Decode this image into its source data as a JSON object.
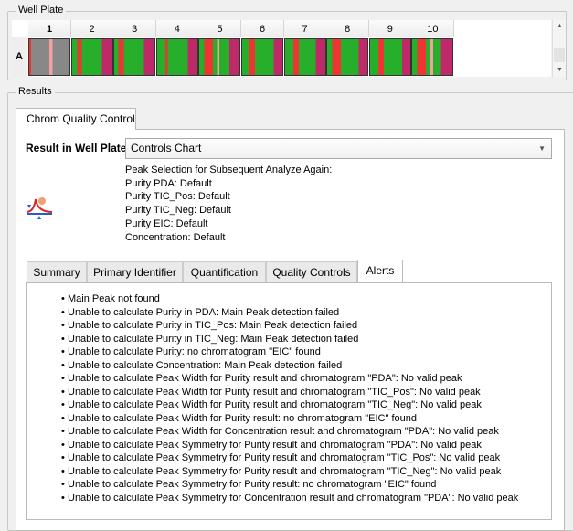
{
  "well_plate": {
    "title": "Well Plate",
    "row_label": "A",
    "columns": [
      "1",
      "2",
      "3",
      "4",
      "5",
      "6",
      "7",
      "8",
      "9",
      "10"
    ]
  },
  "results": {
    "title": "Results",
    "main_tab": "Chrom Quality Control",
    "result_label": "Result in Well Plate:",
    "result_value": "Controls Chart",
    "peak_selection": [
      "Peak Selection for Subsequent Analyze Again:",
      "Purity PDA: Default",
      "Purity TIC_Pos: Default",
      "Purity TIC_Neg: Default",
      "Purity EIC: Default",
      "Concentration: Default"
    ],
    "tabs": [
      "Summary",
      "Primary Identifier",
      "Quantification",
      "Quality Controls",
      "Alerts"
    ],
    "active_tab": "Alerts",
    "alerts": [
      "Main Peak not found",
      "Unable to calculate Purity in PDA: Main Peak detection failed",
      "Unable to calculate Purity in TIC_Pos: Main Peak detection failed",
      "Unable to calculate Purity in TIC_Neg: Main Peak detection failed",
      "Unable to calculate Purity: no chromatogram \"EIC\" found",
      "Unable to calculate Concentration: Main Peak detection failed",
      "Unable to calculate Peak Width for Purity result and chromatogram \"PDA\": No valid peak",
      "Unable to calculate Peak Width for Purity result and chromatogram \"TIC_Pos\": No valid peak",
      "Unable to calculate Peak Width for Purity result and chromatogram \"TIC_Neg\": No valid peak",
      "Unable to calculate Peak Width for Purity result: no chromatogram \"EIC\" found",
      "Unable to calculate Peak Width for Concentration result and chromatogram \"PDA\": No valid peak",
      "Unable to calculate Peak Symmetry for Purity result and chromatogram \"PDA\": No valid peak",
      "Unable to calculate Peak Symmetry for Purity result and chromatogram \"TIC_Pos\": No valid peak",
      "Unable to calculate Peak Symmetry for Purity result and chromatogram \"TIC_Neg\": No valid peak",
      "Unable to calculate Peak Symmetry for Purity result: no chromatogram \"EIC\" found",
      "Unable to calculate Peak Symmetry for Concentration result and chromatogram \"PDA\": No valid peak"
    ]
  },
  "colors": {
    "pass": "#27ae2b",
    "fail": "#ef3434",
    "warn": "#be2a68",
    "none": "#888888"
  }
}
